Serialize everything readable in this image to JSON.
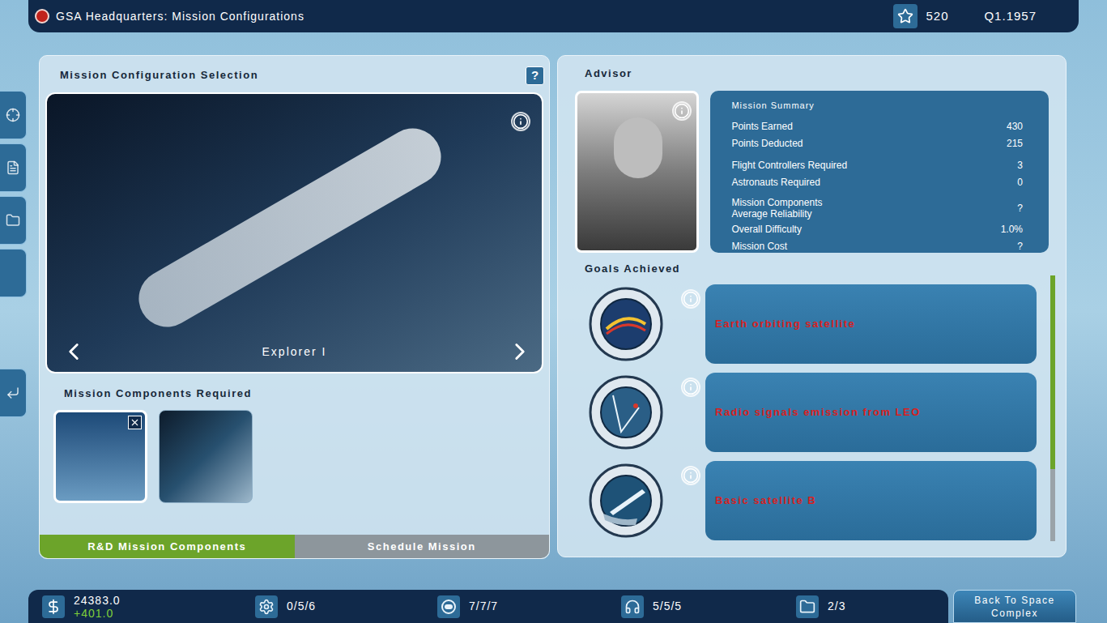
{
  "header": {
    "title": "GSA Headquarters: Mission Configurations",
    "prestige": "520",
    "date": "Q1.1957"
  },
  "configuration": {
    "heading": "Mission Configuration Selection",
    "help": "?",
    "mission": "Explorer I"
  },
  "components": {
    "heading": "Mission Components Required",
    "items": [
      {
        "selected": true
      },
      {
        "selected": false
      }
    ]
  },
  "tabs": [
    {
      "label": "R&D Mission Components",
      "selected": true
    },
    {
      "label": "Schedule Mission",
      "selected": false
    }
  ],
  "advisor": {
    "heading": "Advisor"
  },
  "summary": {
    "title": "Mission Summary",
    "groups": [
      [
        {
          "label": "Points Earned",
          "value": "430"
        },
        {
          "label": "Points Deducted",
          "value": "215"
        }
      ],
      [
        {
          "label": "Flight Controllers Required",
          "value": "3"
        },
        {
          "label": "Astronauts Required",
          "value": "0"
        }
      ],
      [
        {
          "label": "Mission Components\nAverage Reliability",
          "value": "?"
        },
        {
          "label": "Overall Difficulty",
          "value": "1.0%"
        },
        {
          "label": "Mission Cost",
          "value": "?"
        }
      ]
    ]
  },
  "goals": {
    "heading": "Goals Achieved",
    "items": [
      {
        "label": "Earth orbiting satellite"
      },
      {
        "label": "Radio signals emission from LEO"
      },
      {
        "label": "Basic satellite B"
      }
    ],
    "scrollbar": {
      "level": 0.73
    }
  },
  "status_bar": {
    "funds": "24383.0",
    "income": "+401.0",
    "stats": [
      "0/5/6",
      "7/7/7",
      "5/5/5",
      "2/3"
    ],
    "back_button": "Back To Space Complex"
  }
}
